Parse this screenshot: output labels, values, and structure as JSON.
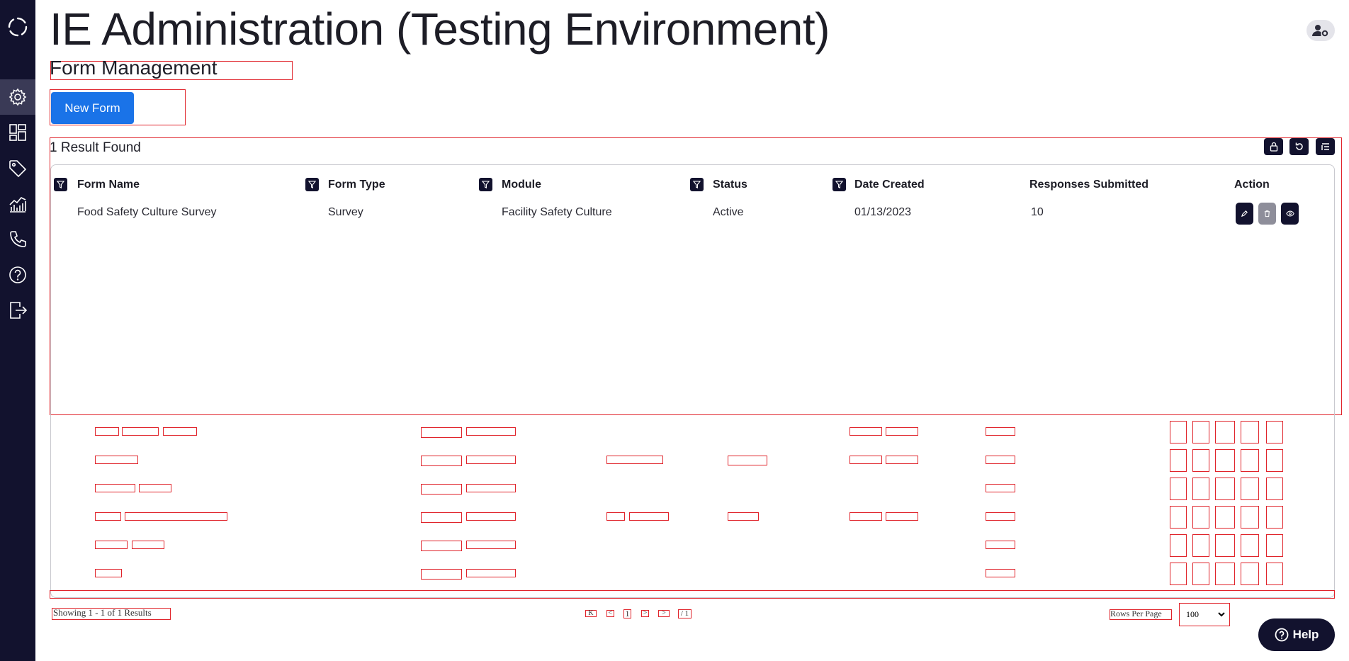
{
  "app": {
    "title": "IE Administration (Testing Environment)"
  },
  "sidebar": {
    "logo_icon": "ring-logo-icon",
    "items": [
      {
        "name": "settings",
        "icon": "gear-icon",
        "active": true
      },
      {
        "name": "dashboard",
        "icon": "dashboard-icon",
        "active": false
      },
      {
        "name": "tags",
        "icon": "tag-icon",
        "active": false
      },
      {
        "name": "analytics",
        "icon": "chart-icon",
        "active": false
      },
      {
        "name": "contact",
        "icon": "phone-icon",
        "active": false
      },
      {
        "name": "help",
        "icon": "question-icon",
        "active": false
      },
      {
        "name": "logout",
        "icon": "logout-icon",
        "active": false
      }
    ]
  },
  "header": {
    "user_icon": "user-settings-icon"
  },
  "page": {
    "subtitle": "Form Management",
    "new_form_label": "New Form",
    "results_text": "1 Result Found"
  },
  "toolbar": {
    "icons": [
      "lock-icon",
      "refresh-icon",
      "columns-icon"
    ]
  },
  "table": {
    "columns": [
      "Form Name",
      "Form Type",
      "Module",
      "Status",
      "Date Created",
      "Responses Submitted",
      "Action"
    ],
    "rows": [
      {
        "form_name": "Food Safety Culture Survey",
        "form_type": "Survey",
        "module": "Facility Safety Culture",
        "status": "Active",
        "date_created": "01/13/2023",
        "responses": "10"
      }
    ],
    "action_icons": [
      "edit-icon",
      "trash-icon",
      "eye-icon"
    ]
  },
  "footer": {
    "showing_text": "Showing 1 - 1 of 1 Results",
    "pager": {
      "first": "K",
      "prev": "<",
      "current": "1",
      "next": ">",
      "last": ">",
      "total": "/ 1"
    },
    "rows_per_page_label": "Rows Per Page",
    "rows_per_page_value": "100"
  },
  "help_label": "Help",
  "colors": {
    "sidebar": "#12122e",
    "primary": "#1a73e8",
    "debug_outline": "#e0242b"
  }
}
